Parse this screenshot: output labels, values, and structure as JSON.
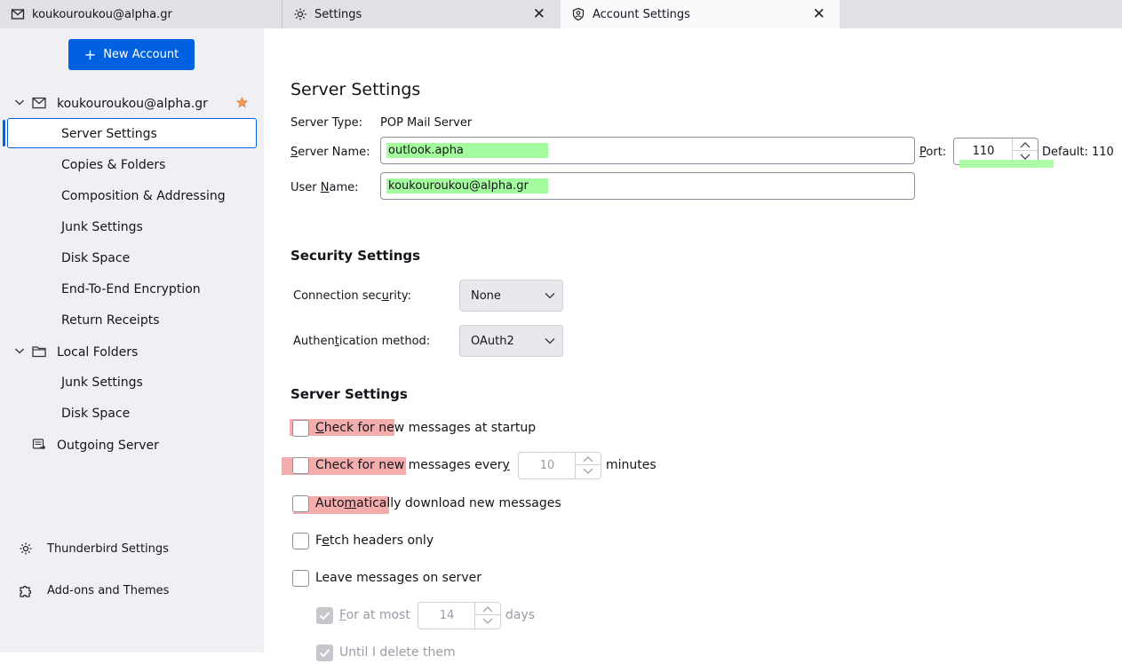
{
  "tabs": [
    {
      "label": "koukouroukou@alpha.gr",
      "icon": "envelope-icon"
    },
    {
      "label": "Settings",
      "icon": "gear-icon"
    },
    {
      "label": "Account Settings",
      "icon": "account-settings-icon",
      "active": true
    }
  ],
  "tab_close_glyph": "✕",
  "sidebar": {
    "new_account_label": "New Account",
    "account": {
      "label": "koukouroukou@alpha.gr"
    },
    "account_items": [
      "Server Settings",
      "Copies & Folders",
      "Composition & Addressing",
      "Junk Settings",
      "Disk Space",
      "End-To-End Encryption",
      "Return Receipts"
    ],
    "local_folders": {
      "label": "Local Folders"
    },
    "local_items": [
      "Junk Settings",
      "Disk Space"
    ],
    "outgoing_server": "Outgoing Server",
    "thunderbird_settings": "Thunderbird Settings",
    "addons": "Add-ons and Themes"
  },
  "main": {
    "title": "Server Settings",
    "server_type_label": "Server Type:",
    "server_type_value": "POP Mail Server",
    "server_name_label_pre": "",
    "server_name_label_u": "S",
    "server_name_label_post": "erver Name:",
    "server_name_value": "outlook.apha",
    "port_label_u": "P",
    "port_label_post": "ort:",
    "port_value": "110",
    "port_default": "Default: 110",
    "user_name_label_pre": "User ",
    "user_name_label_u": "N",
    "user_name_label_post": "ame:",
    "user_name_value": "koukouroukou@alpha.gr",
    "security_title": "Security Settings",
    "connection_security_pre": "Connection sec",
    "connection_security_u": "u",
    "connection_security_post": "rity:",
    "connection_security_value": "None",
    "auth_method_pre": "Authen",
    "auth_method_u": "t",
    "auth_method_post": "ication method:",
    "auth_method_value": "OAuth2",
    "server_settings_title": "Server Settings",
    "check_startup_pre": "",
    "check_startup_u": "C",
    "check_startup_post": "heck for new messages at startup",
    "check_every_pre": "Check for new messages ever",
    "check_every_u": "y",
    "check_every_minutes_value": "10",
    "minutes_label": "minutes",
    "auto_download_pre": "Auto",
    "auto_download_u": "m",
    "auto_download_post": "atically download new messages",
    "fetch_headers_pre": "F",
    "fetch_headers_u": "e",
    "fetch_headers_post": "tch headers only",
    "leave_messages_pre": "Leave messa",
    "leave_messages_u": "g",
    "leave_messages_post": "es on server",
    "for_at_most_pre": "",
    "for_at_most_u": "F",
    "for_at_most_post": "or at most",
    "for_at_most_value": "14",
    "days_label": "days",
    "until_delete": "Until I delete them"
  }
}
